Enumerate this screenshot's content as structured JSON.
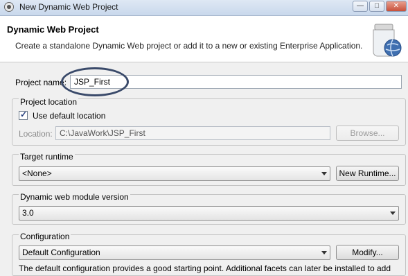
{
  "window": {
    "title": "New Dynamic Web Project"
  },
  "titlebar_buttons": [
    "minimize-icon",
    "maximize-icon",
    "close-icon"
  ],
  "banner": {
    "title": "Dynamic Web Project",
    "description": "Create a standalone Dynamic Web project or add it to a new or existing Enterprise Application."
  },
  "project_name": {
    "label": "Project name:",
    "value": "JSP_First"
  },
  "project_location": {
    "group_label": "Project location",
    "use_default_label": "Use default location",
    "use_default_checked": true,
    "location_label": "Location:",
    "location_value": "C:\\JavaWork\\JSP_First",
    "browse_label": "Browse..."
  },
  "target_runtime": {
    "group_label": "Target runtime",
    "selected": "<None>",
    "new_runtime_label": "New Runtime..."
  },
  "module_version": {
    "group_label": "Dynamic web module version",
    "selected": "3.0"
  },
  "configuration": {
    "group_label": "Configuration",
    "selected": "Default Configuration",
    "modify_label": "Modify...",
    "description": "The default configuration provides a good starting point. Additional facets can later be installed to add"
  },
  "colors": {
    "annotation_oval": "#3a4a6a",
    "title_gradient_top": "#dfe8f4"
  }
}
